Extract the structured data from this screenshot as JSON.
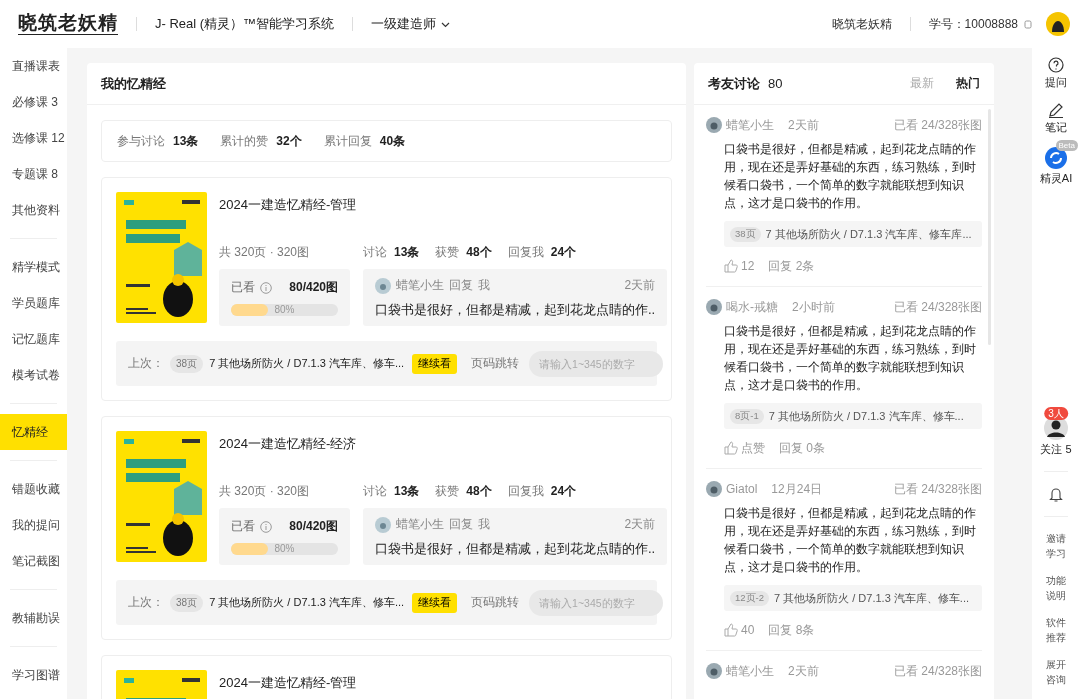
{
  "header": {
    "logo": "晓筑老妖精",
    "system_title": "J- Real (精灵）™智能学习系统",
    "exam_selector": "一级建造师",
    "username": "晓筑老妖精",
    "student_id": "学号：10008888"
  },
  "sidebar": {
    "groups": [
      [
        {
          "label": "直播课表",
          "selected": false
        },
        {
          "label": "必修课 3",
          "selected": false
        },
        {
          "label": "选修课 12",
          "selected": false
        },
        {
          "label": "专题课 8",
          "selected": false
        },
        {
          "label": "其他资料",
          "selected": false
        }
      ],
      [
        {
          "label": "精学模式",
          "selected": false
        },
        {
          "label": "学员题库",
          "selected": false
        },
        {
          "label": "记忆题库",
          "selected": false
        },
        {
          "label": "模考试卷",
          "selected": false
        }
      ],
      [
        {
          "label": "忆精经",
          "selected": true
        }
      ],
      [
        {
          "label": "错题收藏",
          "selected": false
        },
        {
          "label": "我的提问",
          "selected": false
        },
        {
          "label": "笔记截图",
          "selected": false
        }
      ],
      [
        {
          "label": "教辅勘误",
          "selected": false
        }
      ],
      [
        {
          "label": "学习图谱",
          "selected": false
        }
      ]
    ]
  },
  "main": {
    "title": "我的忆精经",
    "summary": [
      {
        "label": "参与讨论",
        "value": "13条"
      },
      {
        "label": "累计的赞",
        "value": "32个"
      },
      {
        "label": "累计回复",
        "value": "40条"
      }
    ],
    "books": [
      {
        "cover": {
          "kind": "picture"
        },
        "title": "2024一建造忆精经-管理",
        "pages": "共  320页 · 320图",
        "stats": [
          {
            "label": "讨论",
            "value": "13条"
          },
          {
            "label": "获赞",
            "value": "48个"
          },
          {
            "label": "回复我",
            "value": "24个"
          }
        ],
        "progress": {
          "label": "已看",
          "count": "80/420图",
          "level": 0.35,
          "percent": "80%"
        },
        "latest_reply": {
          "user": "蜡笔小生",
          "action": "回复",
          "target": "我",
          "time": "2天前",
          "text": "口袋书是很好，但都是精减，起到花龙点睛的作.."
        },
        "last_read": {
          "label": "上次：",
          "page": "38页",
          "chapter": "7 其他场所防火 / D7.1.3 汽车库、修车...",
          "continue_button": "继续看",
          "jump_label": "页码跳转",
          "jump_placeholder": "请输入1~345的数字"
        }
      },
      {
        "cover": {
          "kind": "picture"
        },
        "title": "2024一建造忆精经-经济",
        "pages": "共  320页 · 320图",
        "stats": [
          {
            "label": "讨论",
            "value": "13条"
          },
          {
            "label": "获赞",
            "value": "48个"
          },
          {
            "label": "回复我",
            "value": "24个"
          }
        ],
        "progress": {
          "label": "已看",
          "count": "80/420图",
          "level": 0.35,
          "percent": "80%"
        },
        "latest_reply": {
          "user": "蜡笔小生",
          "action": "回复",
          "target": "我",
          "time": "2天前",
          "text": "口袋书是很好，但都是精减，起到花龙点睛的作.."
        },
        "last_read": {
          "label": "上次：",
          "page": "38页",
          "chapter": "7 其他场所防火 / D7.1.3 汽车库、修车...",
          "continue_button": "继续看",
          "jump_label": "页码跳转",
          "jump_placeholder": "请输入1~345的数字"
        }
      },
      {
        "cover": {
          "kind": "picture"
        },
        "title": "2024一建造忆精经-管理"
      }
    ]
  },
  "discussion": {
    "title": "考友讨论",
    "count": "80",
    "tabs": [
      {
        "label": "最新",
        "selected": false
      },
      {
        "label": "热门",
        "selected": true
      }
    ],
    "comments": [
      {
        "user": "蜡笔小生",
        "time": "2天前",
        "viewed": "已看  24/328张图",
        "text": "口袋书是很好，但都是精减，起到花龙点睛的作用，现在还是弄好基础的东西，练习熟练，到时候看口袋书，一个简单的数字就能联想到知识点，这才是口袋书的作用。",
        "page": "38页",
        "chapter": "7 其他场所防火 / D7.1.3 汽车库、修车库...",
        "likes": "12",
        "replies": "回复 2条"
      },
      {
        "user": "喝水-戒糖",
        "time": "2小时前",
        "viewed": "已看  24/328张图",
        "text": "口袋书是很好，但都是精减，起到花龙点睛的作用，现在还是弄好基础的东西，练习熟练，到时候看口袋书，一个简单的数字就能联想到知识点，这才是口袋书的作用。",
        "page": "8页-1",
        "chapter": "7 其他场所防火 / D7.1.3 汽车库、修车...",
        "likes": "点赞",
        "replies": "回复 0条"
      },
      {
        "user": "Giatol",
        "time": "12月24日",
        "viewed": "已看  24/328张图",
        "text": "口袋书是很好，但都是精减，起到花龙点睛的作用，现在还是弄好基础的东西，练习熟练，到时候看口袋书，一个简单的数字就能联想到知识点，这才是口袋书的作用。",
        "page": "12页-2",
        "chapter": "7 其他场所防火 / D7.1.3 汽车库、修车...",
        "likes": "40",
        "replies": "回复 8条"
      },
      {
        "user": "蜡笔小生",
        "time": "2天前",
        "viewed": "已看  24/328张图"
      }
    ]
  },
  "rail": {
    "tools": [
      {
        "label": "提问",
        "kind": "question"
      },
      {
        "label": "笔记",
        "kind": "note"
      },
      {
        "label": "精灵AI",
        "kind": "ai",
        "badge": "Beta"
      }
    ],
    "follow": {
      "badge": "3人",
      "label": "关注 5"
    },
    "links": [
      "邀请学习",
      "功能说明",
      "软件推荐",
      "展开咨询"
    ]
  }
}
